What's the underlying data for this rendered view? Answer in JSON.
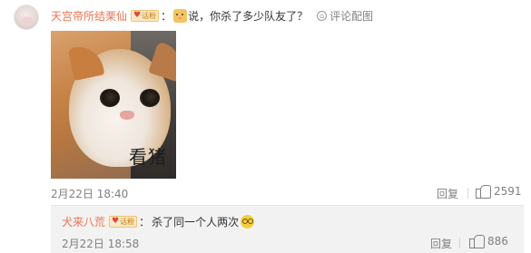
{
  "comment": {
    "username": "天宫帝所结栗仙",
    "badge_text": "话粉",
    "colon": "：",
    "sticker_icon": "cat-sticker-icon",
    "text": "说，你杀了多少队友了？",
    "report_label": "评论配图",
    "image_caption": "看猪",
    "date": "2月22日 18:40",
    "reply_label": "回复",
    "like_count": "2591"
  },
  "reply": {
    "username": "犬来八荒",
    "badge_text": "话粉",
    "colon": "：",
    "text": "杀了同一个人两次",
    "emoji_icon": "glasses-smile-emoji-icon",
    "date": "2月22日 18:58",
    "reply_label": "回复",
    "like_count": "886"
  },
  "colors": {
    "username": "#eb7350",
    "meta": "#808080",
    "reply_bg": "#f2f2f2"
  }
}
